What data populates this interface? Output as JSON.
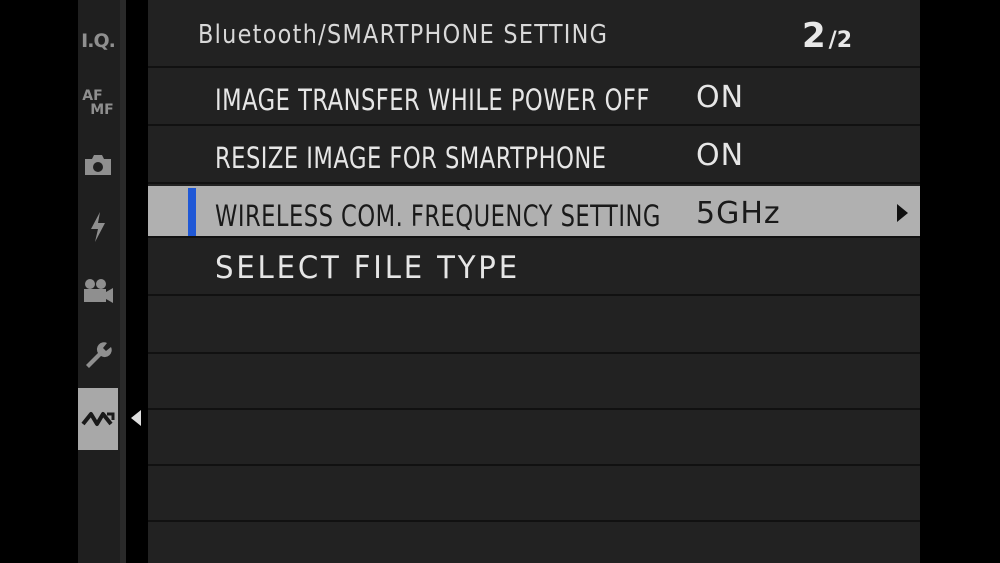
{
  "tabs": [
    {
      "id": "iq",
      "label": "I.Q.",
      "icon": "image-quality-icon",
      "active": false
    },
    {
      "id": "afmf",
      "label_top": "AF",
      "label_bottom": "MF",
      "icon": "focus-mode-icon",
      "active": false
    },
    {
      "id": "shooting",
      "icon": "camera-icon",
      "active": false
    },
    {
      "id": "flash",
      "icon": "flash-icon",
      "active": false
    },
    {
      "id": "movie",
      "icon": "movie-camera-icon",
      "active": false
    },
    {
      "id": "setup",
      "icon": "wrench-icon",
      "active": false
    },
    {
      "id": "connection",
      "icon": "connection-icon",
      "active": true
    }
  ],
  "header": {
    "title": "Bluetooth/SMARTPHONE SETTING",
    "page_current": "2",
    "page_total": "/2"
  },
  "menu": {
    "items": [
      {
        "label": "IMAGE TRANSFER WHILE POWER OFF",
        "value": "ON"
      },
      {
        "label": "RESIZE IMAGE FOR SMARTPHONE",
        "value": "ON"
      },
      {
        "label": "WIRELESS COM. FREQUENCY SETTING",
        "value": "5GHz",
        "selected": true
      },
      {
        "label": "SELECT FILE TYPE",
        "value": ""
      }
    ]
  },
  "colors": {
    "selection_marker": "#1f58d6",
    "selected_row": "#b0b0b0",
    "panel_bg": "#222222"
  }
}
